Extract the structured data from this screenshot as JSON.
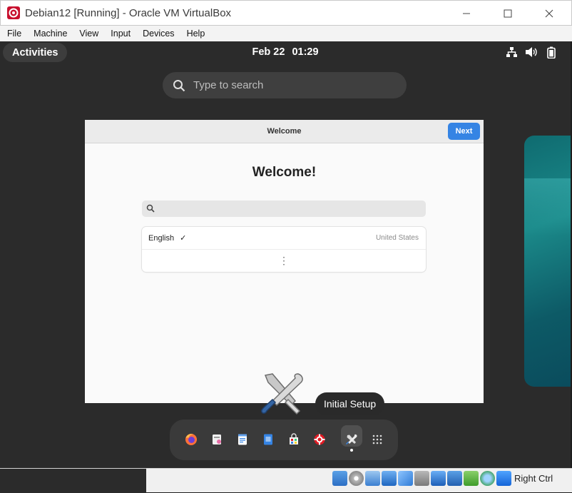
{
  "window": {
    "title": "Debian12 [Running] - Oracle VM VirtualBox",
    "minimize_glyph": "—",
    "maximize_glyph": "☐",
    "close_glyph": "✕"
  },
  "menubar": [
    "File",
    "Machine",
    "View",
    "Input",
    "Devices",
    "Help"
  ],
  "topbar": {
    "activities": "Activities",
    "date": "Feb 22",
    "time": "01:29"
  },
  "overview_search": {
    "placeholder": "Type to search"
  },
  "welcome_window": {
    "title": "Welcome",
    "next_label": "Next",
    "heading": "Welcome!",
    "languages": [
      {
        "language": "English",
        "checked": "✓",
        "country": "United States"
      }
    ],
    "more_glyph": "⋮"
  },
  "dock": {
    "tooltip": "Initial Setup",
    "apps": [
      "firefox-icon",
      "files-icon",
      "text-editor-icon",
      "documents-icon",
      "software-icon",
      "help-icon",
      "initial-setup-icon",
      "app-grid-icon"
    ]
  },
  "statusbar": {
    "host_key": "Right Ctrl"
  },
  "colors": {
    "accent": "#3584e4",
    "panel": "#2b2b2b",
    "vbox_red": "#c8102e"
  }
}
